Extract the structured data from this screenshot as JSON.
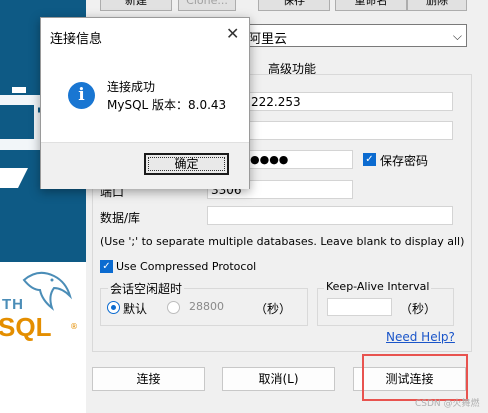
{
  "toolbar": {
    "new_label": "新建",
    "clone_label": "Clone...",
    "save_label": "保存",
    "rename_label": "重命名",
    "delete_label": "删除"
  },
  "connection_combo": {
    "value": "阿里云"
  },
  "tabs": {
    "advanced": "高级功能"
  },
  "form": {
    "host_value": "222.253",
    "password_masked": "●●●●",
    "save_password_label": "保存密码",
    "port_label": "端口",
    "port_value": "3306",
    "database_label": "数据/库",
    "database_value": "",
    "database_hint": "(Use ';' to separate multiple databases. Leave blank to display all)",
    "compressed_label": "Use Compressed Protocol"
  },
  "idle_timeout": {
    "title": "会话空闲超时",
    "default_label": "默认",
    "custom_value": "28800",
    "unit": "（秒）"
  },
  "keepalive": {
    "title": "Keep-Alive Interval",
    "value": "",
    "unit": "（秒）"
  },
  "help_link": "Need Help?",
  "buttons": {
    "connect": "连接",
    "cancel": "取消(L)",
    "test": "测试连接"
  },
  "dialog": {
    "title": "连接信息",
    "message_line1": "连接成功",
    "message_line2": "MySQL 版本：8.0.43",
    "ok": "确定"
  },
  "logo": {
    "text_top": "TH",
    "text_main": "SQL"
  },
  "watermark": "CSDN @火舞燃",
  "colors": {
    "accent": "#0b6bd0",
    "link": "#1a55c9",
    "highlight": "#e8534f",
    "panel_blue": "#0e5a85",
    "info_icon": "#1976d2"
  }
}
